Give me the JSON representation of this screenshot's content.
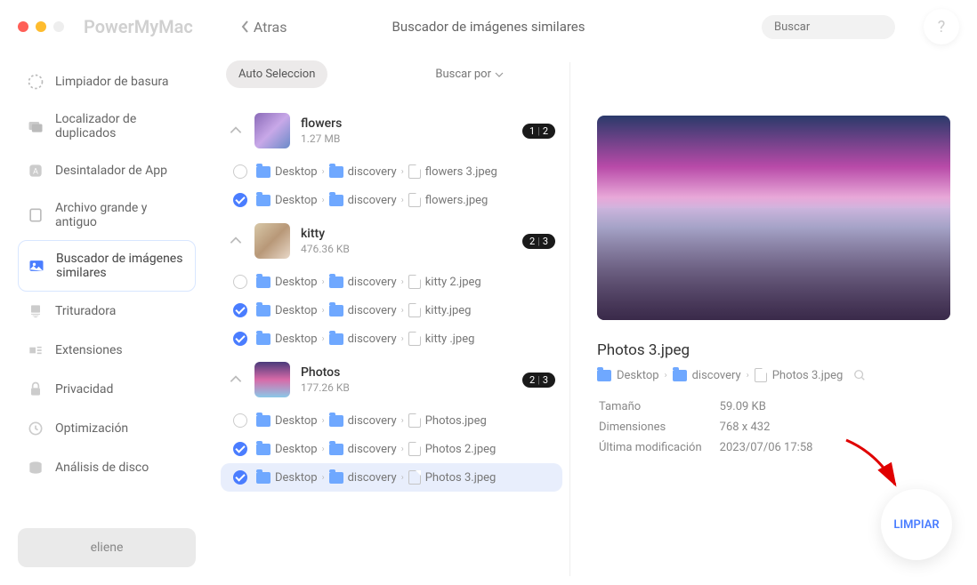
{
  "app": {
    "name": "PowerMyMac",
    "back": "Atras",
    "title": "Buscador de imágenes similares"
  },
  "search": {
    "placeholder": "Buscar"
  },
  "help": "?",
  "sidebar": {
    "items": [
      {
        "label": "Limpiador de basura"
      },
      {
        "label": "Localizador de duplicados"
      },
      {
        "label": "Desintalador de App"
      },
      {
        "label": "Archivo grande y antiguo"
      },
      {
        "label": "Buscador de imágenes similares"
      },
      {
        "label": "Trituradora"
      },
      {
        "label": "Extensiones"
      },
      {
        "label": "Privacidad"
      },
      {
        "label": "Optimización"
      },
      {
        "label": "Análisis de disco"
      }
    ],
    "user": "eliene"
  },
  "controls": {
    "auto": "Auto Seleccion",
    "sort": "Buscar por"
  },
  "groups": [
    {
      "name": "flowers",
      "size": "1.27 MB",
      "badge_a": "1",
      "badge_b": "2",
      "files": [
        {
          "checked": false,
          "path": [
            "Desktop",
            "discovery"
          ],
          "file": "flowers 3.jpeg"
        },
        {
          "checked": true,
          "path": [
            "Desktop",
            "discovery"
          ],
          "file": "flowers.jpeg"
        }
      ]
    },
    {
      "name": "kitty",
      "size": "476.36 KB",
      "badge_a": "2",
      "badge_b": "3",
      "files": [
        {
          "checked": false,
          "path": [
            "Desktop",
            "discovery"
          ],
          "file": "kitty 2.jpeg"
        },
        {
          "checked": true,
          "path": [
            "Desktop",
            "discovery"
          ],
          "file": "kitty.jpeg"
        },
        {
          "checked": true,
          "path": [
            "Desktop",
            "discovery"
          ],
          "file": "kitty .jpeg"
        }
      ]
    },
    {
      "name": "Photos",
      "size": "177.26 KB",
      "badge_a": "2",
      "badge_b": "3",
      "files": [
        {
          "checked": false,
          "path": [
            "Desktop",
            "discovery"
          ],
          "file": "Photos.jpeg"
        },
        {
          "checked": true,
          "path": [
            "Desktop",
            "discovery"
          ],
          "file": "Photos 2.jpeg"
        },
        {
          "checked": true,
          "path": [
            "Desktop",
            "discovery"
          ],
          "file": "Photos 3.jpeg",
          "selected": true
        }
      ]
    }
  ],
  "detail": {
    "filename": "Photos 3.jpeg",
    "path": [
      "Desktop",
      "discovery",
      "Photos 3.jpeg"
    ],
    "meta": {
      "size_label": "Tamaño",
      "size": "59.09 KB",
      "dim_label": "Dimensiones",
      "dim": "768 x 432",
      "mod_label": "Última modificación",
      "mod": "2023/07/06 17:58"
    }
  },
  "clean": "LIMPIAR"
}
